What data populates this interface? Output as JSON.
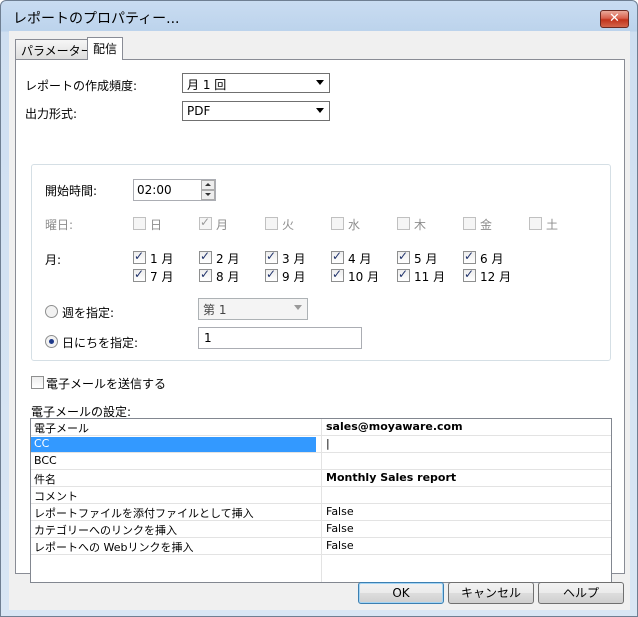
{
  "window": {
    "title": "レポートのプロパティー...",
    "close_label": "✕"
  },
  "tabs": [
    {
      "label": "パラメーター",
      "active": false
    },
    {
      "label": "配信",
      "active": true
    }
  ],
  "frequency": {
    "label": "レポートの作成頻度:",
    "value": "月 1 回"
  },
  "output": {
    "label": "出力形式:",
    "value": "PDF"
  },
  "schedule": {
    "start_label": "開始時間:",
    "start_value": "02:00",
    "weekday_label": "曜日:",
    "weekdays": [
      {
        "label": "日",
        "checked": false
      },
      {
        "label": "月",
        "checked": true
      },
      {
        "label": "火",
        "checked": false
      },
      {
        "label": "水",
        "checked": false
      },
      {
        "label": "木",
        "checked": false
      },
      {
        "label": "金",
        "checked": false
      },
      {
        "label": "土",
        "checked": false
      }
    ],
    "month_label": "月:",
    "months": [
      {
        "label": "1 月",
        "checked": true
      },
      {
        "label": "2 月",
        "checked": true
      },
      {
        "label": "3 月",
        "checked": true
      },
      {
        "label": "4 月",
        "checked": true
      },
      {
        "label": "5 月",
        "checked": true
      },
      {
        "label": "6 月",
        "checked": true
      },
      {
        "label": "7 月",
        "checked": true
      },
      {
        "label": "8 月",
        "checked": true
      },
      {
        "label": "9 月",
        "checked": true
      },
      {
        "label": "10 月",
        "checked": true
      },
      {
        "label": "11 月",
        "checked": true
      },
      {
        "label": "12 月",
        "checked": true
      }
    ],
    "week_radio_label": "週を指定:",
    "week_value": "第 1",
    "day_radio_label": "日にちを指定:",
    "day_value": "1"
  },
  "email": {
    "send_label": "電子メールを送信する",
    "send_checked": false,
    "settings_label": "電子メールの設定:",
    "rows": [
      {
        "key": "電子メール",
        "value": "sales@moyaware.com",
        "bold": true
      },
      {
        "key": "CC",
        "value": "|",
        "bold": false
      },
      {
        "key": "BCC",
        "value": "",
        "bold": false
      },
      {
        "key": "件名",
        "value": "Monthly Sales report",
        "bold": true
      },
      {
        "key": "コメント",
        "value": "",
        "bold": false
      },
      {
        "key": "レポートファイルを添付ファイルとして挿入",
        "value": "False",
        "bold": false
      },
      {
        "key": "カテゴリーへのリンクを挿入",
        "value": "False",
        "bold": false
      },
      {
        "key": "レポートへの Webリンクを挿入",
        "value": "False",
        "bold": false
      }
    ]
  },
  "buttons": {
    "ok": "OK",
    "cancel": "キャンセル",
    "help": "ヘルプ"
  }
}
